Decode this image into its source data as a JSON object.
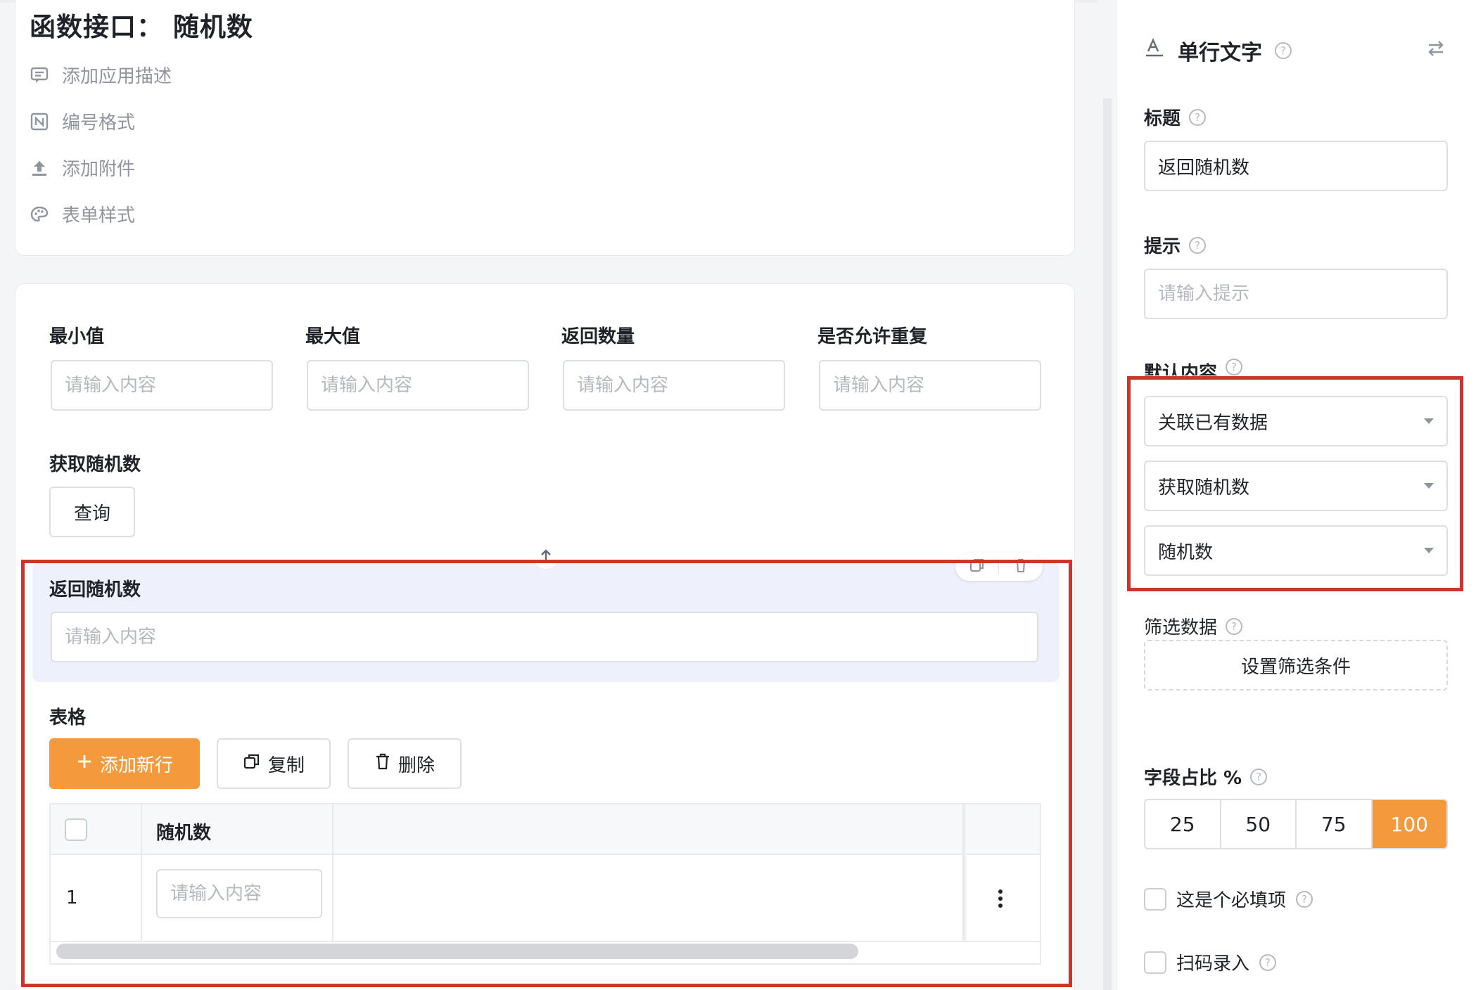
{
  "app": {
    "title": "函数接口： 随机数",
    "meta": [
      {
        "label": "添加应用描述",
        "icon": "comment-icon"
      },
      {
        "label": "编号格式",
        "icon": "numbering-icon"
      },
      {
        "label": "添加附件",
        "icon": "upload-icon"
      },
      {
        "label": "表单样式",
        "icon": "palette-icon"
      }
    ]
  },
  "form": {
    "params": [
      {
        "label": "最小值",
        "placeholder": "请输入内容"
      },
      {
        "label": "最大值",
        "placeholder": "请输入内容"
      },
      {
        "label": "返回数量",
        "placeholder": "请输入内容"
      },
      {
        "label": "是否允许重复",
        "placeholder": "请输入内容"
      }
    ],
    "fetch": {
      "label": "获取随机数",
      "button": "查询"
    },
    "result": {
      "label": "返回随机数",
      "placeholder": "请输入内容"
    },
    "table": {
      "label": "表格",
      "add_button": "添加新行",
      "copy_button": "复制",
      "delete_button": "删除",
      "columns": [
        "随机数"
      ],
      "rows": [
        {
          "index": "1",
          "placeholder": "请输入内容"
        }
      ]
    }
  },
  "panel": {
    "field_type": "单行文字",
    "title_label": "标题",
    "title_value": "返回随机数",
    "hint_label": "提示",
    "hint_placeholder": "请输入提示",
    "default_label": "默认内容",
    "default_selects": [
      "关联已有数据",
      "获取随机数",
      "随机数"
    ],
    "filter_label": "筛选数据",
    "filter_button": "设置筛选条件",
    "ratio_label": "字段占比 %",
    "ratio_options": [
      "25",
      "50",
      "75",
      "100"
    ],
    "ratio_selected": "100",
    "required_label": "这是个必填项",
    "scan_label": "扫码录入"
  },
  "colors": {
    "accent": "#f59a3c",
    "highlight": "#c9372c",
    "selected_bg": "#eef0fb"
  }
}
